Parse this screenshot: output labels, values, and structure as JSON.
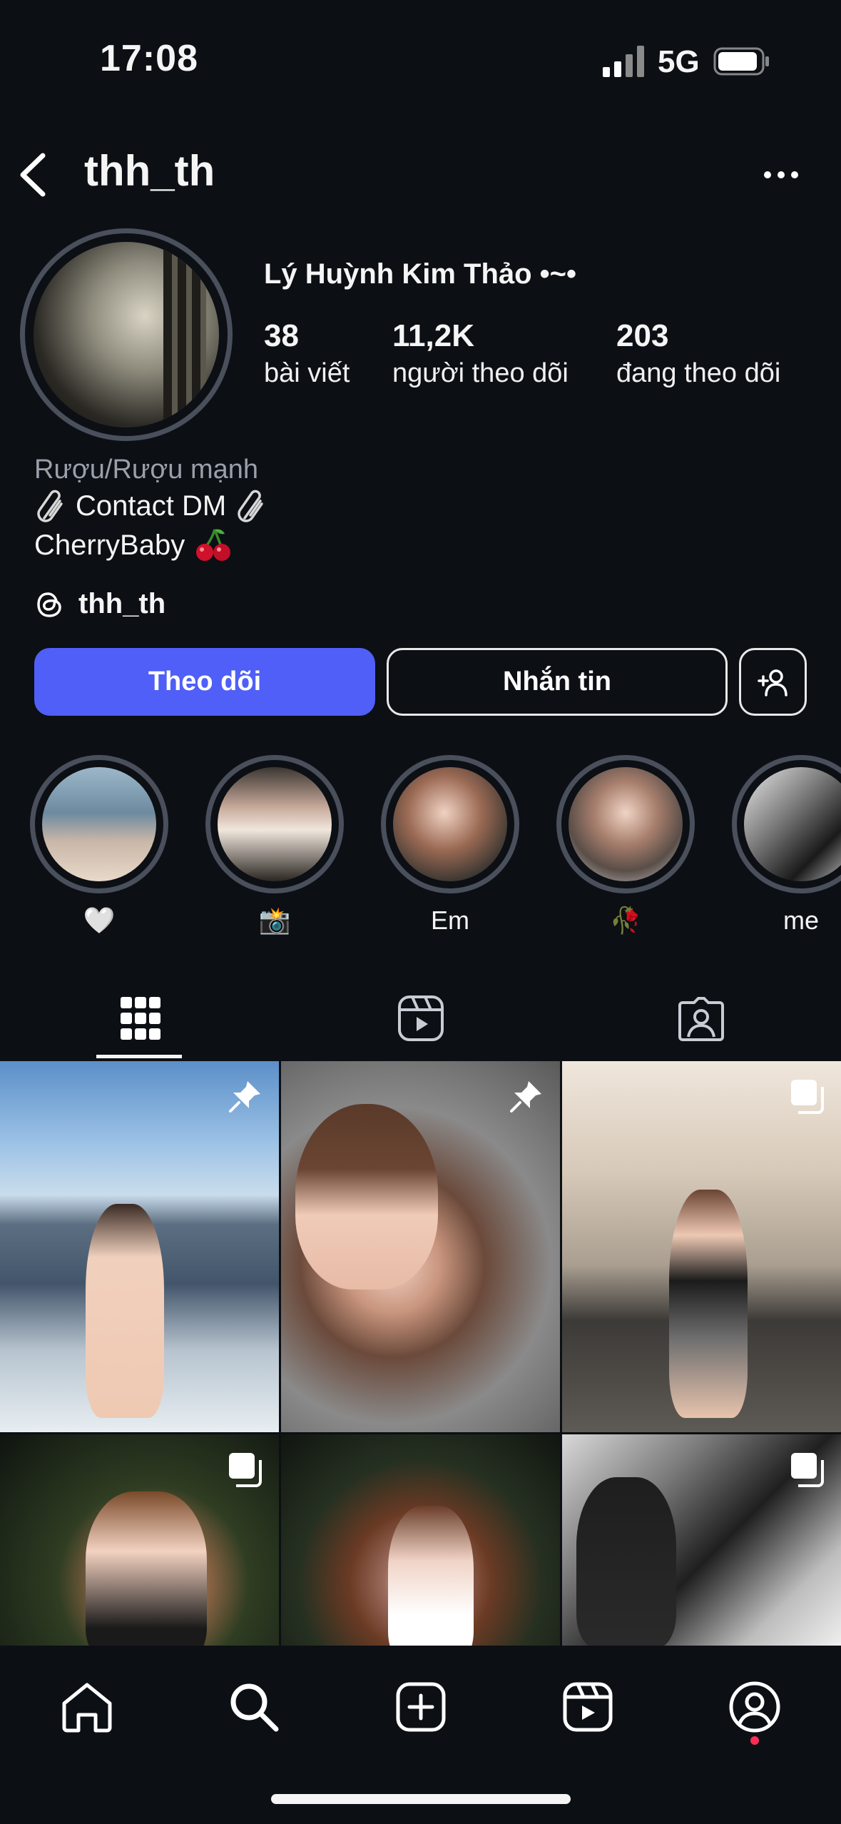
{
  "status_bar": {
    "time": "17:08",
    "network": "5G",
    "icons": [
      "signal-icon",
      "battery-icon"
    ]
  },
  "header": {
    "username": "thh_th",
    "icons": [
      "back-arrow-icon",
      "more-options-icon"
    ]
  },
  "profile": {
    "display_name": "Lý Huỳnh Kim Thảo •~•",
    "stats": [
      {
        "value": "38",
        "label": "bài viết"
      },
      {
        "value": "11,2K",
        "label": "người theo dõi"
      },
      {
        "value": "203",
        "label": "đang theo dõi"
      }
    ],
    "category": "Rượu/Rượu mạnh",
    "bio_line1": "Contact DM",
    "bio_line2": "CherryBaby",
    "threads_handle": "thh_th"
  },
  "actions": {
    "follow_label": "Theo dõi",
    "message_label": "Nhắn tin",
    "add_user_icon": "add-person-icon",
    "follow_color": "#4f5ff7"
  },
  "highlights": [
    {
      "caption": "🤍"
    },
    {
      "caption": "📸"
    },
    {
      "caption": "Em"
    },
    {
      "caption": "🥀"
    },
    {
      "caption": "me"
    }
  ],
  "tabs": [
    {
      "name": "posts",
      "icon": "grid-icon",
      "active": true
    },
    {
      "name": "reels",
      "icon": "reels-icon",
      "active": false
    },
    {
      "name": "tagged",
      "icon": "tagged-icon",
      "active": false
    }
  ],
  "grid": [
    {
      "badge": "pin-icon"
    },
    {
      "badge": "pin-icon"
    },
    {
      "badge": "carousel-icon"
    },
    {
      "badge": "carousel-icon"
    },
    {
      "badge": ""
    },
    {
      "badge": "carousel-icon"
    }
  ],
  "bottom_nav": [
    "home-icon",
    "search-icon",
    "create-icon",
    "reels-icon",
    "profile-icon"
  ]
}
